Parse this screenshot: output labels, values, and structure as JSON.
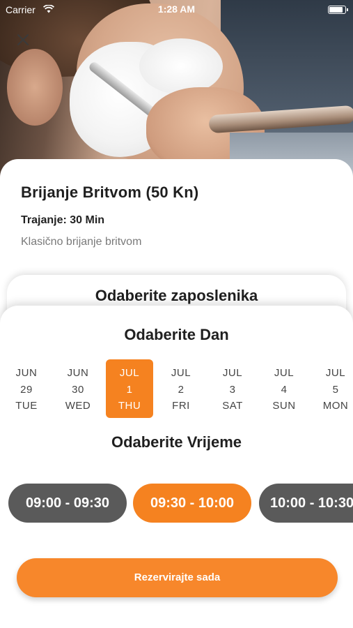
{
  "status_bar": {
    "carrier": "Carrier",
    "time": "1:28 AM"
  },
  "service": {
    "title": "Brijanje Britvom (50 Kn)",
    "duration": "Trajanje: 30 Min",
    "description": "Klasično brijanje britvom"
  },
  "employee_section": {
    "title": "Odaberite zaposlenika"
  },
  "day_section": {
    "title": "Odaberite Dan",
    "days": [
      {
        "month": "JUN",
        "day": "29",
        "weekday": "TUE",
        "selected": false
      },
      {
        "month": "JUN",
        "day": "30",
        "weekday": "WED",
        "selected": false
      },
      {
        "month": "JUL",
        "day": "1",
        "weekday": "THU",
        "selected": true
      },
      {
        "month": "JUL",
        "day": "2",
        "weekday": "FRI",
        "selected": false
      },
      {
        "month": "JUL",
        "day": "3",
        "weekday": "SAT",
        "selected": false
      },
      {
        "month": "JUL",
        "day": "4",
        "weekday": "SUN",
        "selected": false
      },
      {
        "month": "JUL",
        "day": "5",
        "weekday": "MON",
        "selected": false
      }
    ]
  },
  "time_section": {
    "title": "Odaberite Vrijeme",
    "slots": [
      {
        "label": "09:00 - 09:30",
        "selected": false
      },
      {
        "label": "09:30 - 10:00",
        "selected": true
      },
      {
        "label": "10:00 - 10:30",
        "selected": false
      }
    ]
  },
  "book_button": {
    "label": "Rezervirajte sada"
  },
  "colors": {
    "accent": "#f58220",
    "slot_inactive": "#5a5a5a",
    "text_dark": "#1f1f1f",
    "text_muted": "#7a7a7a"
  }
}
